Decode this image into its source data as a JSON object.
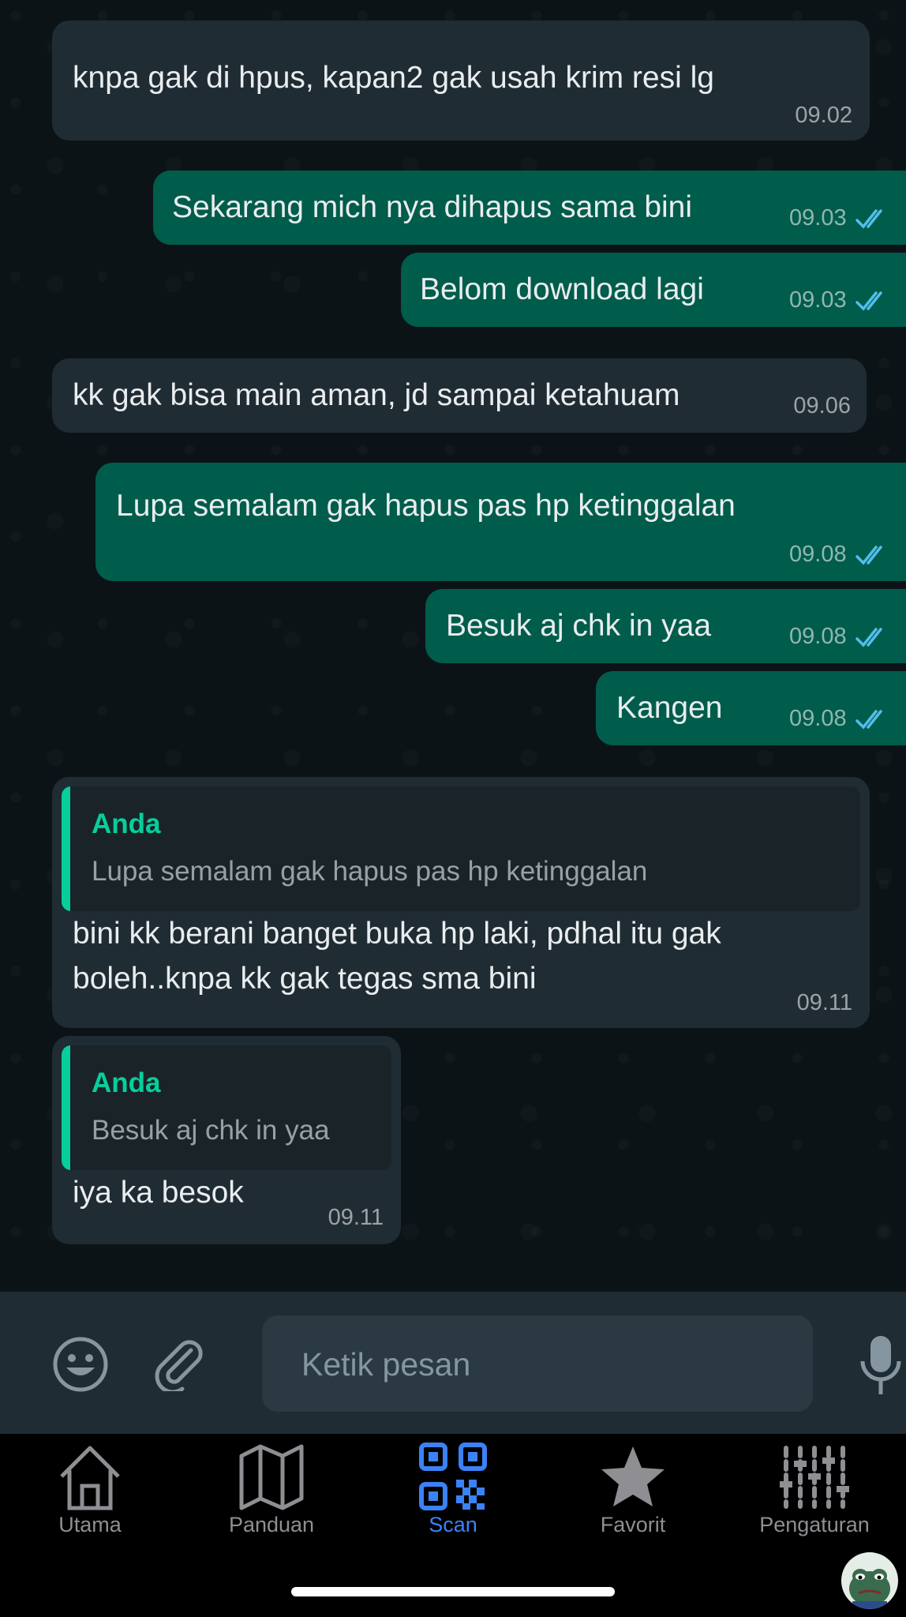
{
  "messages": [
    {
      "direction": "in",
      "text": "knpa gak di hpus, kapan2 gak usah krim resi lg",
      "time": "09.02"
    },
    {
      "direction": "out",
      "text": "Sekarang mich nya dihapus sama bini",
      "time": "09.03",
      "status": "read"
    },
    {
      "direction": "out",
      "text": "Belom download lagi",
      "time": "09.03",
      "status": "read"
    },
    {
      "direction": "in",
      "text": "kk gak bisa main aman, jd sampai ketahuam",
      "time": "09.06"
    },
    {
      "direction": "out",
      "text": "Lupa semalam gak hapus pas hp ketinggalan",
      "time": "09.08",
      "status": "read"
    },
    {
      "direction": "out",
      "text": "Besuk aj chk in yaa",
      "time": "09.08",
      "status": "read"
    },
    {
      "direction": "out",
      "text": "Kangen",
      "time": "09.08",
      "status": "read"
    },
    {
      "direction": "in",
      "quote": {
        "author": "Anda",
        "text": "Lupa semalam gak hapus pas hp ketinggalan"
      },
      "lines": [
        "bini kk berani banget buka hp laki, pdhal itu gak",
        "boleh..knpa kk gak tegas sma bini"
      ],
      "time": "09.11"
    },
    {
      "direction": "in",
      "quote": {
        "author": "Anda",
        "text": "Besuk aj chk in yaa"
      },
      "text": "iya ka besok",
      "time": "09.11"
    }
  ],
  "composer": {
    "placeholder": "Ketik pesan",
    "emoji_icon": "emoji-icon",
    "attach_icon": "paperclip-icon",
    "mic_icon": "microphone-icon"
  },
  "tabs": [
    {
      "label": "Utama",
      "icon": "home-icon",
      "active": false
    },
    {
      "label": "Panduan",
      "icon": "map-icon",
      "active": false
    },
    {
      "label": "Scan",
      "icon": "qr-code-icon",
      "active": true
    },
    {
      "label": "Favorit",
      "icon": "star-icon",
      "active": false
    },
    {
      "label": "Pengaturan",
      "icon": "sliders-icon",
      "active": false
    }
  ],
  "colors": {
    "incoming_bubble": "#202c33",
    "outgoing_bubble": "#005c4b",
    "quote_accent": "#06cf9c",
    "read_ticks": "#53bdeb",
    "active_tab": "#3b82f6"
  }
}
